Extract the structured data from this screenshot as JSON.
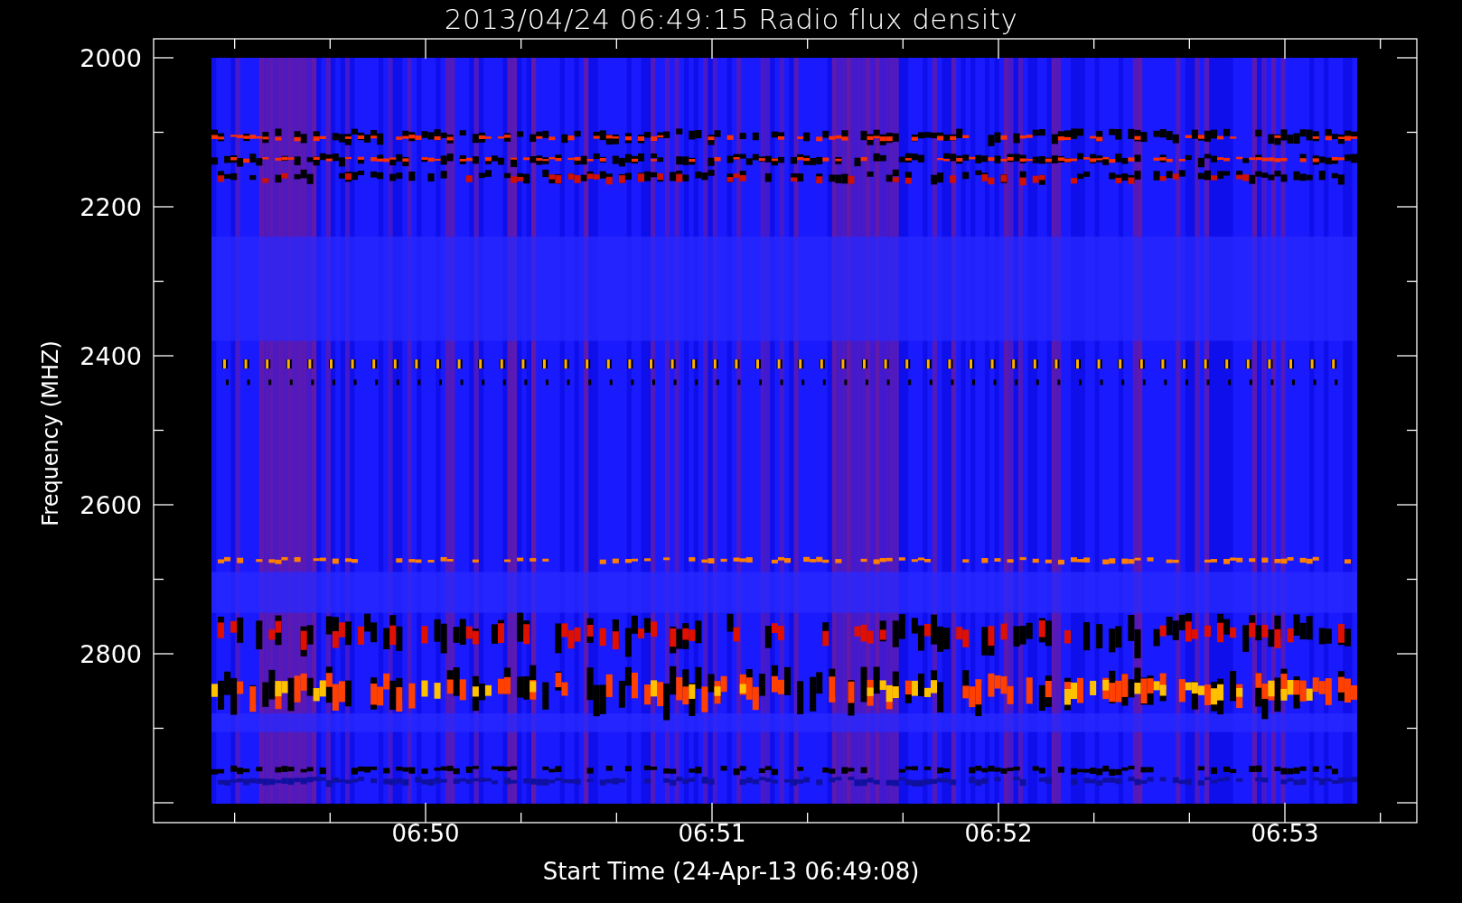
{
  "title": "2013/04/24 06:49:15 Radio flux density",
  "y_axis": {
    "label": "Frequency (MHZ)",
    "ticks": [
      "2000",
      "2200",
      "2400",
      "2600",
      "2800"
    ]
  },
  "x_axis": {
    "label": "Start Time (24-Apr-13 06:49:08)",
    "ticks": [
      "06:50",
      "06:51",
      "06:52",
      "06:53"
    ]
  }
}
